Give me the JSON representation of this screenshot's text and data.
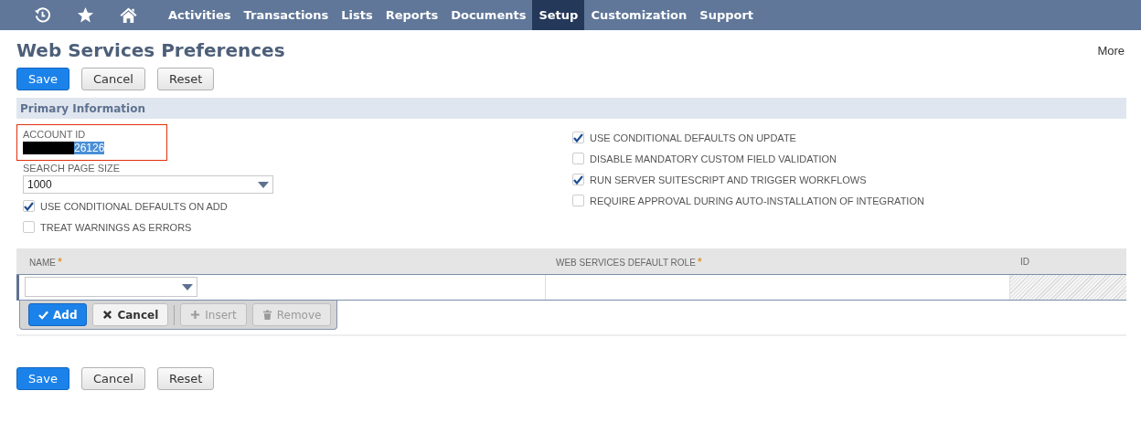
{
  "nav": {
    "items": [
      {
        "label": "Activities",
        "selected": false
      },
      {
        "label": "Transactions",
        "selected": false
      },
      {
        "label": "Lists",
        "selected": false
      },
      {
        "label": "Reports",
        "selected": false
      },
      {
        "label": "Documents",
        "selected": false
      },
      {
        "label": "Setup",
        "selected": true
      },
      {
        "label": "Customization",
        "selected": false
      },
      {
        "label": "Support",
        "selected": false
      }
    ]
  },
  "page": {
    "title": "Web Services Preferences",
    "more": "More"
  },
  "buttons": [
    {
      "label": "Save",
      "kind": "primary"
    },
    {
      "label": "Cancel",
      "kind": "secondary"
    },
    {
      "label": "Reset",
      "kind": "secondary"
    }
  ],
  "section": {
    "title": "Primary Information"
  },
  "account_id": {
    "label": "ACCOUNT ID",
    "value": "26126",
    "redacted": true
  },
  "search_page_size": {
    "label": "SEARCH PAGE SIZE",
    "value": "1000"
  },
  "left_checks": [
    {
      "label": "USE CONDITIONAL DEFAULTS ON ADD",
      "checked": true
    },
    {
      "label": "TREAT WARNINGS AS ERRORS",
      "checked": false
    }
  ],
  "right_checks": [
    {
      "label": "USE CONDITIONAL DEFAULTS ON UPDATE",
      "checked": true
    },
    {
      "label": "DISABLE MANDATORY CUSTOM FIELD VALIDATION",
      "checked": false
    },
    {
      "label": "RUN SERVER SUITESCRIPT AND TRIGGER WORKFLOWS",
      "checked": true
    },
    {
      "label": "REQUIRE APPROVAL DURING AUTO-INSTALLATION OF INTEGRATION",
      "checked": false
    }
  ],
  "table": {
    "columns": [
      {
        "label": "NAME",
        "required_mark": "*"
      },
      {
        "label": "WEB SERVICES DEFAULT ROLE",
        "required_mark": "*"
      },
      {
        "label": "ID"
      }
    ],
    "row_actions": [
      {
        "label": "Add",
        "kind": "primary",
        "disabled": false
      },
      {
        "label": "Cancel",
        "kind": "secondary",
        "disabled": false
      },
      {
        "label": "Insert",
        "kind": "secondary",
        "disabled": true
      },
      {
        "label": "Remove",
        "kind": "secondary",
        "disabled": true
      }
    ]
  },
  "bottom_buttons": [
    {
      "label": "Save",
      "kind": "primary"
    },
    {
      "label": "Cancel",
      "kind": "secondary"
    },
    {
      "label": "Reset",
      "kind": "secondary"
    }
  ]
}
